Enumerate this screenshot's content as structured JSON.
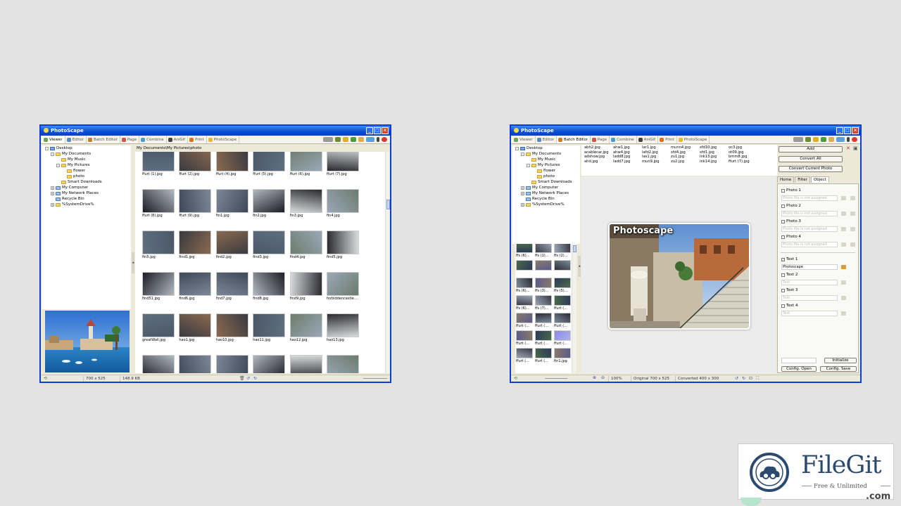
{
  "windows": {
    "left": {
      "title": "PhotoScape",
      "tabs": [
        "Viewer",
        "Editor",
        "Batch Editor",
        "Page",
        "Combine",
        "AniGif",
        "Print",
        "PhotoScape"
      ],
      "active_tab": "Viewer",
      "tree": [
        "Desktop",
        "My Documents",
        "My Music",
        "My Pictures",
        "flower",
        "photo",
        "Smart Downloads",
        "My Computer",
        "My Network Places",
        "Recycle Bin",
        "%SystemDrive%"
      ],
      "path": "My Documents\\My Pictures\\photo",
      "thumbnails": [
        "ffurt (1).jpg",
        "ffurt (2).jpg",
        "ffurt (4).jpg",
        "ffurt (5).jpg",
        "ffurt (6).jpg",
        "ffurt (7).jpg",
        "ffurt (8).jpg",
        "ffurt (9).jpg",
        "fin1.jpg",
        "fin2.jpg",
        "fin3.jpg",
        "fin4.jpg",
        "fin5.jpg",
        "find1.jpg",
        "find2.jpg",
        "find3.jpg",
        "find4.jpg",
        "find5.jpg",
        "find51.jpg",
        "find6.jpg",
        "find7.jpg",
        "find8.jpg",
        "find9.jpg",
        "forbiddencastle....",
        "greatWall.jpg",
        "hao1.jpg",
        "hao10.jpg",
        "hao11.jpg",
        "hao12.jpg",
        "hao13.jpg",
        "",
        "",
        "",
        "",
        "",
        ""
      ],
      "status": {
        "dimensions": "700 x 525",
        "size": "148.9 KB"
      }
    },
    "right": {
      "title": "PhotoScape",
      "tabs": [
        "Viewer",
        "Editor",
        "Batch Editor",
        "Page",
        "Combine",
        "AniGif",
        "Print",
        "PhotoScape"
      ],
      "active_tab": "Batch Editor",
      "tree": [
        "Desktop",
        "My Documents",
        "My Music",
        "My Pictures",
        "flower",
        "photo",
        "Smart Downloads",
        "My Computer",
        "My Network Places",
        "Recycle Bin",
        "%SystemDrive%"
      ],
      "files": [
        [
          "abh2.jpg",
          "acablecar.jpg",
          "adshow.jpg",
          "ahd.jpg"
        ],
        [
          "ahw1.jpg",
          "ahw4.jpg",
          "ladd8.jpg",
          "ladd7.jpg"
        ],
        [
          "lar1.jpg",
          "lafd2.jpg",
          "las1.jpg",
          "mun9.jpg"
        ],
        [
          "munn4.jpg",
          "sfd4.jpg",
          "zu1.jpg",
          "zu2.jpg"
        ],
        [
          "sfd10.jpg",
          "sfd1.jpg",
          "ink13.jpg",
          "ink14.jpg"
        ],
        [
          "oc3.jpg",
          "ot09.jpg",
          "bmm8.jpg",
          "ffurt (7).jpg"
        ]
      ],
      "small_thumbs": [
        "ffs (6)...",
        "ffs (1)...",
        "ffs (2)...",
        "",
        "",
        "",
        "ffs (6)...",
        "ffs (3)...",
        "ffs (5)...",
        "ffs (6)...",
        "ffs (7)...",
        "ffurt (...",
        "ffurt (...",
        "ffurt (...",
        "ffurt (...",
        "ffurt (...",
        "ffurt (...",
        "ffurt (...",
        "ffurt (...",
        "ffurt (...",
        "fin1.jpg"
      ],
      "canvas_text": "Photoscape",
      "buttons": {
        "add": "Add",
        "convert_all": "Convert All",
        "convert_current": "Convert Current Photo"
      },
      "panel_tabs": [
        "Home",
        "Filter",
        "Object"
      ],
      "active_panel_tab": "Object",
      "photo_slots": [
        {
          "label": "Photo 1",
          "file": "Photo file is not assigned"
        },
        {
          "label": "Photo 2",
          "file": "Photo file is not assigned"
        },
        {
          "label": "Photo 3",
          "file": "Photo file is not assigned"
        },
        {
          "label": "Photo 4",
          "file": "Photo file is not assigned"
        }
      ],
      "text_slots": [
        {
          "label": "Text 1",
          "value": "Photoscape",
          "checked": true
        },
        {
          "label": "Text 2",
          "value": "Text",
          "checked": false
        },
        {
          "label": "Text 3",
          "value": "Text",
          "checked": false
        },
        {
          "label": "Text 4",
          "value": "Text",
          "checked": false
        }
      ],
      "footer_buttons": {
        "initialize": "Initialize",
        "config_open": "Config. Open",
        "config_save": "Config. Save"
      },
      "status": {
        "zoom": "100%",
        "original": "Original 700 x 525",
        "converted": "Converted 400 x 300"
      }
    }
  },
  "watermark": {
    "name": "FileGit",
    "tagline": "Free & Unlimited",
    "suffix": ".com"
  }
}
